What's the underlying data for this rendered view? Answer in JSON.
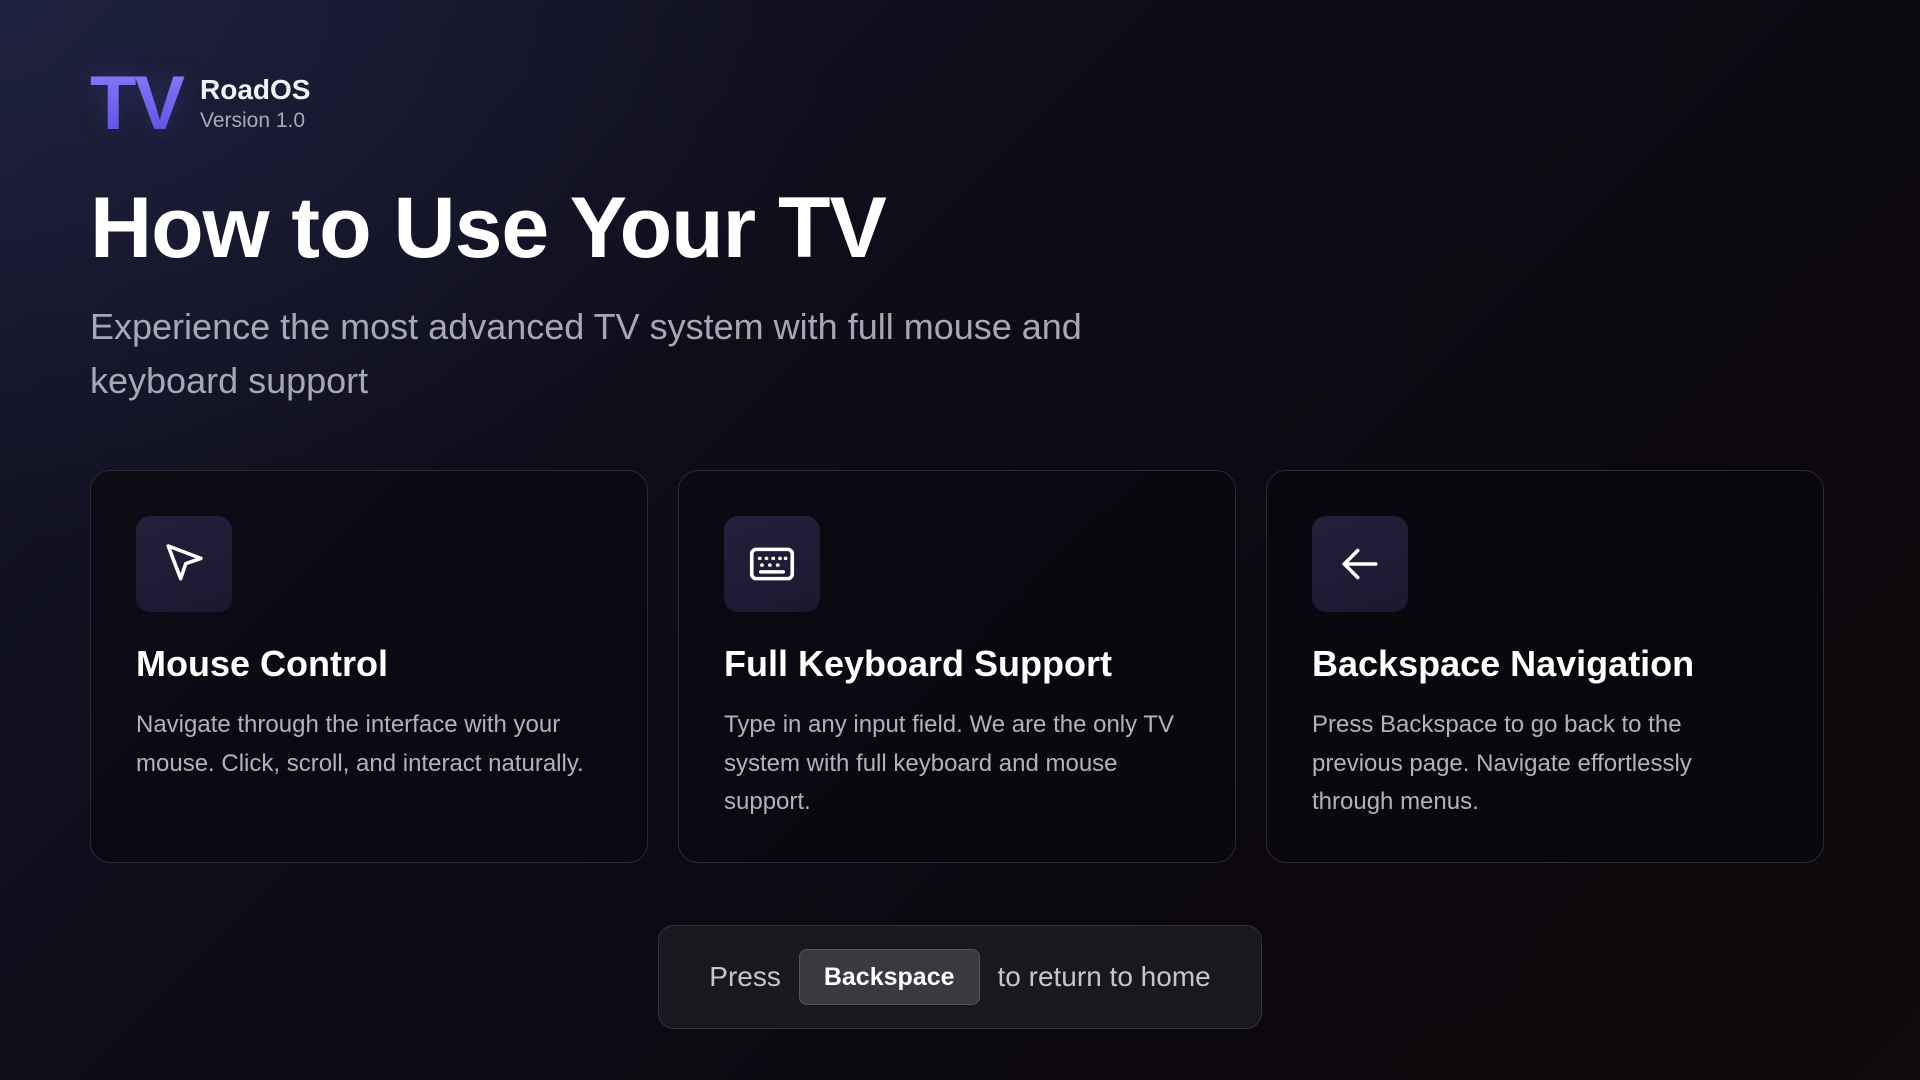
{
  "brand": {
    "logo_text": "TV",
    "name": "RoadOS",
    "version": "Version 1.0"
  },
  "main": {
    "title": "How to Use Your TV",
    "subtitle": "Experience the most advanced TV system with full mouse and keyboard support"
  },
  "cards": [
    {
      "icon": "cursor-icon",
      "title": "Mouse Control",
      "description": "Navigate through the interface with your mouse. Click, scroll, and interact naturally."
    },
    {
      "icon": "keyboard-icon",
      "title": "Full Keyboard Support",
      "description": "Type in any input field. We are the only TV system with full keyboard and mouse support."
    },
    {
      "icon": "arrow-left-icon",
      "title": "Backspace Navigation",
      "description": "Press Backspace to go back to the previous page. Navigate effortlessly through menus."
    }
  ],
  "hint": {
    "prefix": "Press",
    "key": "Backspace",
    "suffix": "to return to home"
  },
  "colors": {
    "accent": "#7b6ff5",
    "background": "#0e0c16",
    "card_border": "#2c2a33",
    "icon_tile": "#221e38"
  }
}
